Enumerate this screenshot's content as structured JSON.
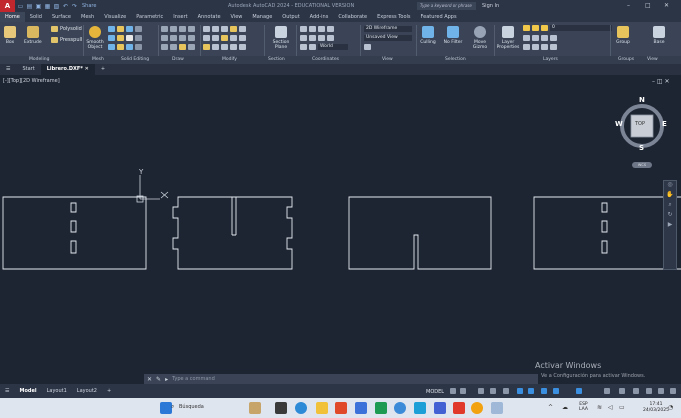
{
  "app": {
    "logo_letter": "A",
    "title": "Autodesk AutoCAD 2024 - EDUCATIONAL VERSION",
    "share_label": "Share",
    "search_placeholder": "Type a keyword or phrase",
    "signin_label": "Sign In"
  },
  "ribbon_tabs": [
    "Home",
    "Solid",
    "Surface",
    "Mesh",
    "Visualize",
    "Parametric",
    "Insert",
    "Annotate",
    "View",
    "Manage",
    "Output",
    "Add-ins",
    "Collaborate",
    "Express Tools",
    "Featured Apps"
  ],
  "ribbon": {
    "box": "Box",
    "extrude": "Extrude",
    "polysolid": "Polysolid",
    "presspull": "Presspull",
    "smooth_object": "Smooth Object",
    "section_plane": "Section Plane",
    "visual_style": "2D Wireframe",
    "view_saved": "Unsaved View",
    "world": "World",
    "culling": "Culling",
    "no_filter": "No Filter",
    "move_gizmo": "Move Gizmo",
    "layer_properties": "Layer Properties",
    "layer_current": "0",
    "group": "Group",
    "base": "Base"
  },
  "panel_titles": [
    "Modeling",
    "Mesh",
    "Solid Editing",
    "Draw",
    "Modify",
    "Section",
    "Coordinates",
    "View",
    "Selection",
    "Layers",
    "Groups",
    "View"
  ],
  "file_tabs": {
    "start": "Start",
    "active": "Librero.DXF*"
  },
  "viewport": {
    "label": "[-][Top][2D Wireframe]",
    "cube_top": "TOP",
    "compass": {
      "n": "N",
      "s": "S",
      "e": "E",
      "w": "W"
    },
    "wcs": "WCS",
    "ucs_y": "Y"
  },
  "command": {
    "placeholder": "Type a command"
  },
  "watermark": {
    "title": "Activar Windows",
    "subtitle": "Ve a Configuración para activar Windows."
  },
  "layout_tabs": [
    "Model",
    "Layout1",
    "Layout2"
  ],
  "status": {
    "model": "MODEL"
  },
  "taskbar": {
    "search": "Búsqueda",
    "lang_top": "ESP",
    "lang_bottom": "LAA",
    "time": "17:41",
    "date": "24/03/2025"
  }
}
